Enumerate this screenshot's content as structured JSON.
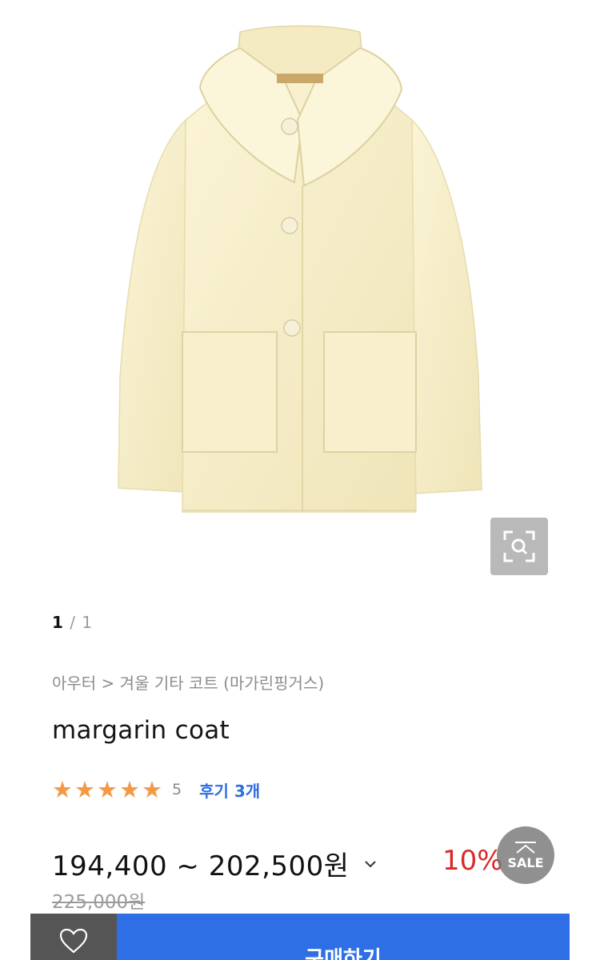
{
  "product": {
    "image_alt": "margarin coat",
    "pager_current": "1",
    "pager_total": "/ 1",
    "breadcrumb": "아우터 > 겨울 기타 코트 (마가린핑거스)",
    "name": "margarin coat",
    "rating_stars": 5,
    "rating_value": "5",
    "review_link": "후기 3개",
    "price_range": "194,400 ~ 202,500원",
    "discount": "10%",
    "original_price": "225,000원"
  },
  "floating": {
    "top_button_label": "SALE"
  },
  "bottom_bar": {
    "buy_label": "구매하기"
  },
  "colors": {
    "accent_blue": "#2f6fe6",
    "discount_red": "#d92a2a",
    "star_orange": "#f29a47",
    "coat_cream": "#f7efc9"
  },
  "icons": {
    "zoom": "zoom-search-icon",
    "chevron": "chevron-down-icon",
    "top": "scroll-top-icon",
    "wish": "heart-icon"
  }
}
